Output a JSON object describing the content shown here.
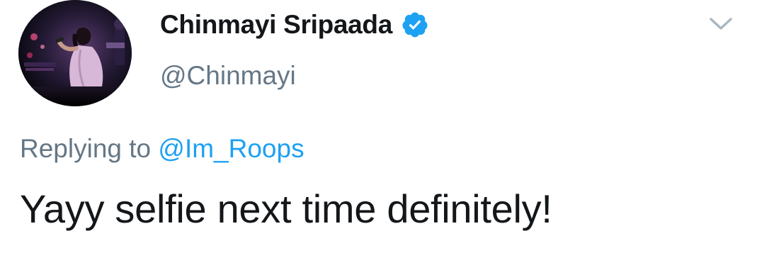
{
  "tweet": {
    "author": {
      "display_name": "Chinmayi Sripaada",
      "handle": "@Chinmayi",
      "verified": true,
      "avatar_icon": "singer-on-stage-photo"
    },
    "reply": {
      "prefix": "Replying to",
      "mention": "@Im_Roops"
    },
    "text": "Yayy selfie next time definitely!",
    "menu_icon": "chevron-down-icon"
  },
  "colors": {
    "text_primary": "#14171a",
    "text_secondary": "#657786",
    "link_blue": "#1da1f2",
    "verified_blue": "#1da1f2",
    "caret_grey": "#aab8c2",
    "background": "#ffffff"
  }
}
